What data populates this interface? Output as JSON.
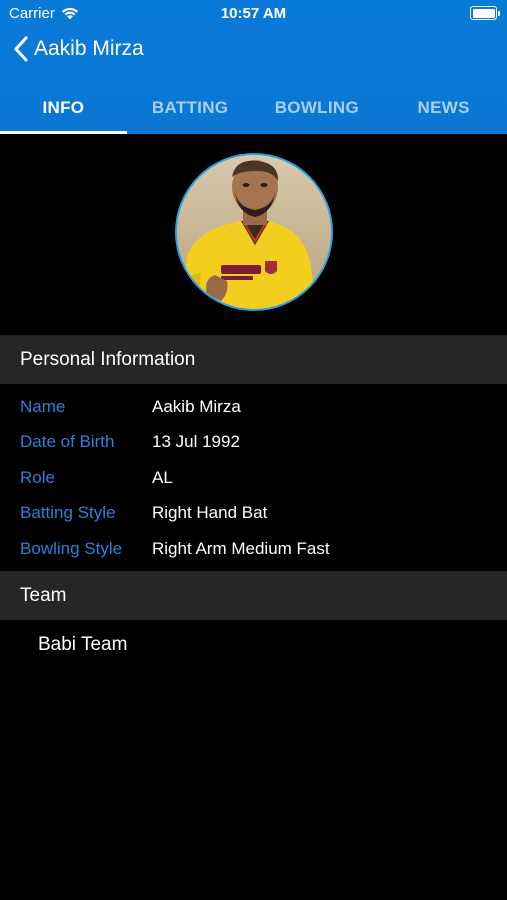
{
  "status_bar": {
    "carrier": "Carrier",
    "time": "10:57 AM",
    "wifi_icon": "wifi-icon",
    "battery_icon": "battery-icon"
  },
  "nav": {
    "back_icon": "chevron-left-icon",
    "title": "Aakib Mirza"
  },
  "tabs": [
    {
      "label": "INFO",
      "active": true
    },
    {
      "label": "BATTING",
      "active": false
    },
    {
      "label": "BOWLING",
      "active": false
    },
    {
      "label": "NEWS",
      "active": false
    }
  ],
  "profile": {
    "avatar": "player-photo"
  },
  "personal_information": {
    "header": "Personal Information",
    "rows": [
      {
        "label": "Name",
        "value": "Aakib Mirza"
      },
      {
        "label": "Date of Birth",
        "value": "13 Jul 1992"
      },
      {
        "label": "Role",
        "value": "AL"
      },
      {
        "label": "Batting Style",
        "value": "Right Hand Bat"
      },
      {
        "label": "Bowling Style",
        "value": "Right Arm Medium Fast"
      }
    ]
  },
  "team": {
    "header": "Team",
    "items": [
      "Babi Team"
    ]
  },
  "colors": {
    "nav_blue": "#0a78d6",
    "label_blue": "#2f7fd8",
    "section_bg": "#262626",
    "avatar_border": "#24a3e6"
  }
}
